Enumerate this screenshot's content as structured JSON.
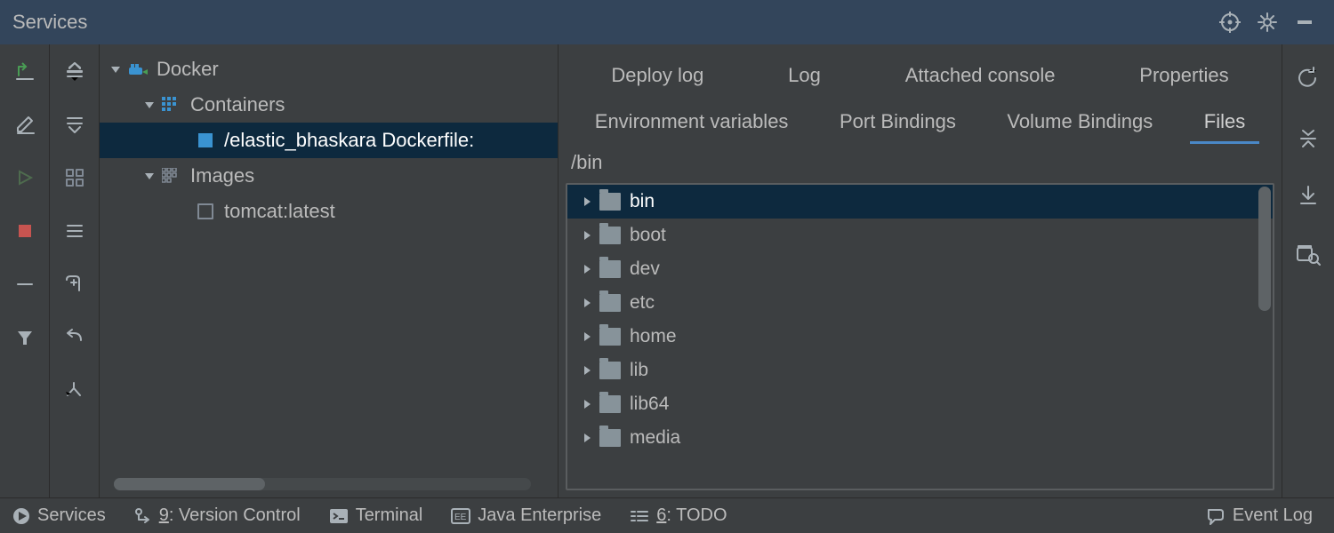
{
  "panel_title": "Services",
  "tree": {
    "root": "Docker",
    "group1": "Containers",
    "container": "/elastic_bhaskara Dockerfile:",
    "group2": "Images",
    "image": "tomcat:latest"
  },
  "tabs": {
    "row1": [
      "Deploy log",
      "Log",
      "Attached console",
      "Properties"
    ],
    "row2": [
      "Environment variables",
      "Port Bindings",
      "Volume Bindings",
      "Files"
    ],
    "active": "Files"
  },
  "files": {
    "path": "/bin",
    "entries": [
      "bin",
      "boot",
      "dev",
      "etc",
      "home",
      "lib",
      "lib64",
      "media"
    ],
    "selected": "bin"
  },
  "footer": {
    "services": "Services",
    "vcs_key": "9",
    "vcs_rest": ": Version Control",
    "terminal": "Terminal",
    "jee": "Java Enterprise",
    "todo_key": "6",
    "todo_rest": ": TODO",
    "eventlog": "Event Log"
  }
}
